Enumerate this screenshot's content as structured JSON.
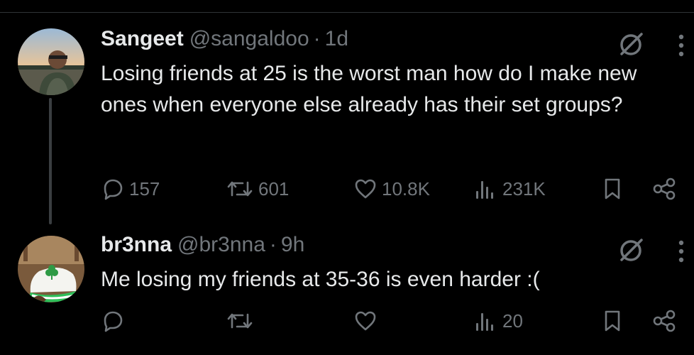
{
  "tweets": [
    {
      "display_name": "Sangeet",
      "handle": "@sangaldoo",
      "separator": "·",
      "time": "1d",
      "text": "Losing friends at 25 is the worst man how do I make new ones when everyone else already has their set groups?",
      "stats": {
        "replies": "157",
        "reposts": "601",
        "likes": "10.8K",
        "views": "231K"
      }
    },
    {
      "display_name": "br3nna",
      "handle": "@br3nna",
      "separator": "·",
      "time": "9h",
      "text": "Me losing my friends at 35-36 is even harder :(",
      "stats": {
        "replies": "",
        "reposts": "",
        "likes": "",
        "views": "20"
      }
    }
  ],
  "colors": {
    "background": "#000000",
    "text": "#e7e9ea",
    "secondary": "#71767b",
    "thread_line": "#3a3e41"
  },
  "icons": [
    "reply-icon",
    "repost-icon",
    "like-icon",
    "views-icon",
    "bookmark-icon",
    "share-icon",
    "grok-icon",
    "more-icon"
  ]
}
